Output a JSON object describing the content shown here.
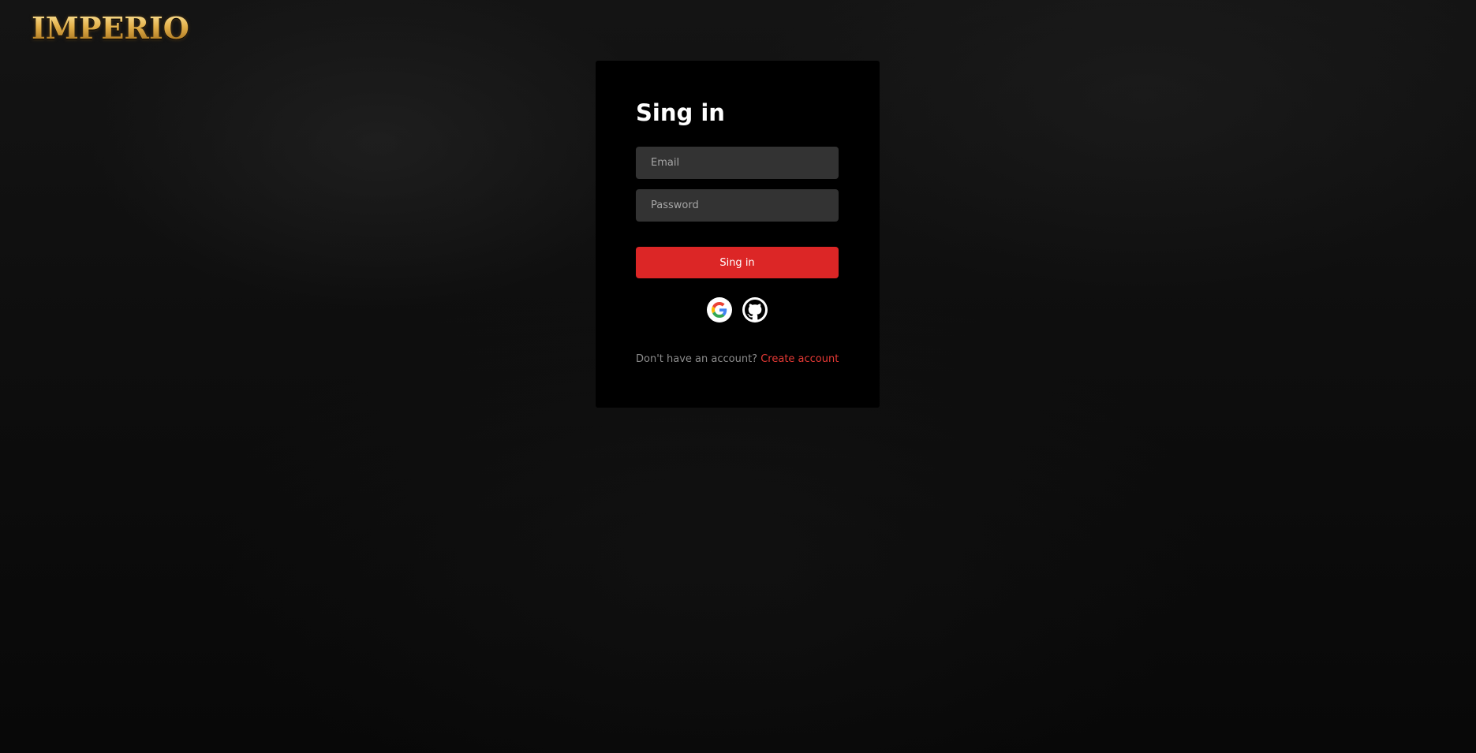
{
  "header": {
    "logo_text": "IMPERIO"
  },
  "login": {
    "title": "Sing in",
    "email_placeholder": "Email",
    "password_placeholder": "Password",
    "submit_label": "Sing in",
    "social": [
      {
        "name": "google",
        "icon": "google-icon"
      },
      {
        "name": "github",
        "icon": "github-icon"
      }
    ],
    "footer_text": "Don't have an account?",
    "create_account_label": "Create account"
  },
  "colors": {
    "accent": "#dc2626",
    "link": "#e53935",
    "card_background": "#000000",
    "input_background": "#333333",
    "logo_gold": "#d9a437"
  }
}
